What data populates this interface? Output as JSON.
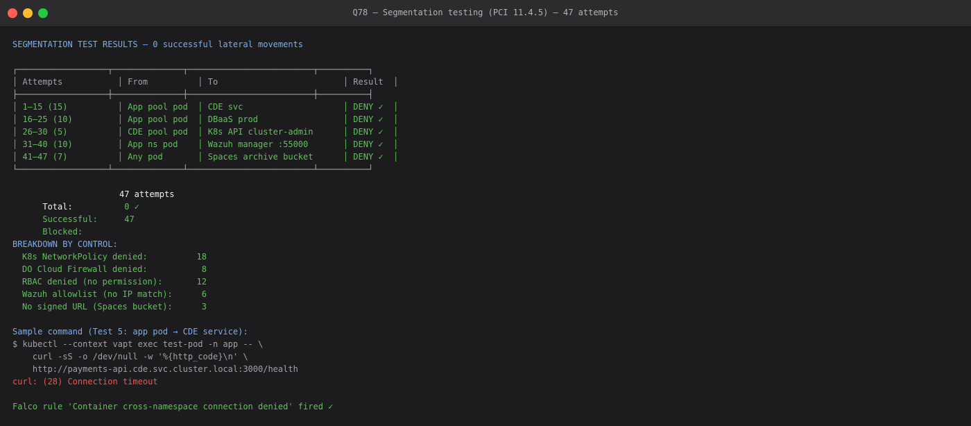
{
  "window": {
    "title": "Q78 — Segmentation testing (PCI 11.4.5) — 47 attempts"
  },
  "heading": "SEGMENTATION TEST RESULTS — 0 successful lateral movements",
  "table": {
    "border_top": "┌──────────────────┬──────────────┬─────────────────────────┬──────────┐",
    "border_mid": "├──────────────────┼──────────────┼─────────────────────────┼──────────┤",
    "border_bottom": "└──────────────────┴──────────────┴─────────────────────────┴──────────┘",
    "headers": [
      "│ Attempts           │ From          │ To                         │ Result  │"
    ],
    "rows": [
      "│ 1–15 (15)          │ App pool pod  │ CDE svc                    │ DENY ✓  │",
      "│ 16–25 (10)         │ App pool pod  │ DBaaS prod                 │ DENY ✓  │",
      "│ 26–30 (5)          │ CDE pool pod  │ K8s API cluster-admin      │ DENY ✓  │",
      "│ 31–40 (10)         │ App ns pod    │ Wazuh manager :55000       │ DENY ✓  │",
      "│ 41–47 (7)          │ Any pod       │ Spaces archive bucket      │ DENY ✓  │"
    ]
  },
  "summary": [
    {
      "label": "Total:",
      "value": "47 attempts"
    },
    {
      "label": "Successful:",
      "value": " 0 ✓"
    },
    {
      "label": "Blocked:",
      "value": " 47"
    }
  ],
  "breakdown": {
    "title": "BREAKDOWN BY CONTROL:",
    "items": [
      {
        "label": "K8s NetworkPolicy denied:",
        "value": "18"
      },
      {
        "label": "DO Cloud Firewall denied:",
        "value": "8"
      },
      {
        "label": "RBAC denied (no permission):",
        "value": "12"
      },
      {
        "label": "Wazuh allowlist (no IP match):",
        "value": "6"
      },
      {
        "label": "No signed URL (Spaces bucket):",
        "value": "3"
      }
    ]
  },
  "sample": {
    "title": "Sample command (Test 5: app pod → CDE service):",
    "lines": [
      "$ kubectl --context vapt exec test-pod -n app -- \\",
      "    curl -sS -o /dev/null -w '%{http_code}\\n' \\",
      "    http://payments-api.cde.svc.cluster.local:3000/health"
    ],
    "error": "curl: (28) Connection timeout"
  },
  "falco": "Falco rule 'Container cross-namespace connection denied' fired ✓"
}
